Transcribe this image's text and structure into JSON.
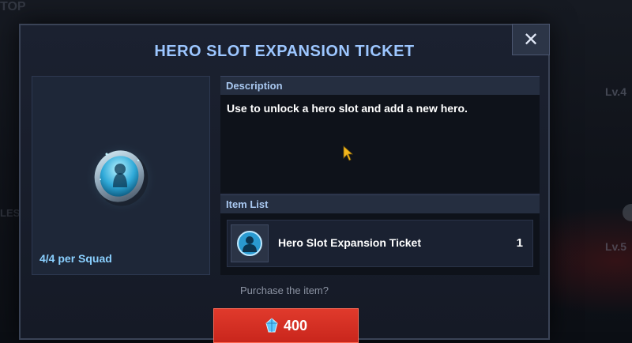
{
  "background": {
    "corner_text": "TOP",
    "side_text": "LES",
    "level_labels": [
      "Lv.4",
      "Lv.5"
    ]
  },
  "dialog": {
    "title": "HERO SLOT EXPANSION TICKET",
    "close_symbol": "✕",
    "item_icon": "hero-slot-ticket-icon",
    "per_squad": "4/4 per Squad",
    "description": {
      "header": "Description",
      "text": "Use to unlock a hero slot and add a new hero."
    },
    "item_list": {
      "header": "Item List",
      "items": [
        {
          "name": "Hero Slot Expansion Ticket",
          "quantity": "1",
          "icon": "hero-silhouette-icon"
        }
      ]
    },
    "confirm_question": "Purchase the item?",
    "purchase": {
      "price": "400",
      "currency_icon": "blue-crystal-icon"
    }
  },
  "colors": {
    "title": "#9cc6ff",
    "accent_blue": "#8ad0ff",
    "buy_button": "#d8301f",
    "panel": "#1e2738"
  }
}
